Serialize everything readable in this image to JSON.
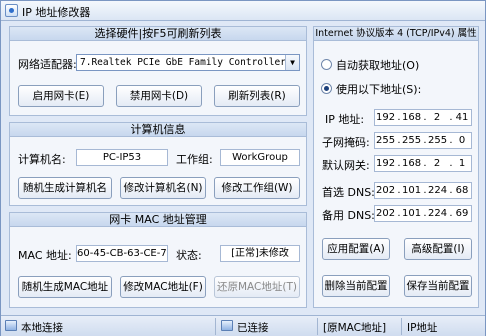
{
  "window": {
    "title": "IP 地址修改器"
  },
  "hardware": {
    "header": "选择硬件|按F5可刷新列表",
    "adapter_label": "网络适配器:",
    "adapter_value": "7.Realtek PCIe GbE Family Controller",
    "enable_btn": "启用网卡(E)",
    "disable_btn": "禁用网卡(D)",
    "refresh_btn": "刷新列表(R)"
  },
  "computer": {
    "header": "计算机信息",
    "name_label": "计算机名:",
    "name_value": "PC-IP53",
    "workgroup_label": "工作组:",
    "workgroup_value": "WorkGroup",
    "random_name_btn": "随机生成计算机名",
    "change_name_btn": "修改计算机名(N)",
    "change_workgroup_btn": "修改工作组(W)"
  },
  "mac": {
    "header": "网卡 MAC 地址管理",
    "mac_label": "MAC 地址:",
    "mac_value": "60-45-CB-63-CE-7C",
    "state_label": "状态:",
    "state_value": "[正常]未修改",
    "random_mac_btn": "随机生成MAC地址",
    "change_mac_btn": "修改MAC地址(F)",
    "restore_mac_btn": "还原MAC地址(T)"
  },
  "ipv4": {
    "header": "Internet 协议版本 4 (TCP/IPv4) 属性",
    "auto_label": "自动获取地址(O)",
    "manual_label": "使用以下地址(S):",
    "selected": "manual",
    "ip_label": "IP 地址:",
    "ip": [
      "192",
      "168",
      "2",
      "41"
    ],
    "mask_label": "子网掩码:",
    "mask": [
      "255",
      "255",
      "255",
      "0"
    ],
    "gateway_label": "默认网关:",
    "gateway": [
      "192",
      "168",
      "2",
      "1"
    ],
    "dns1_label": "首选 DNS:",
    "dns1": [
      "202",
      "101",
      "224",
      "68"
    ],
    "dns2_label": "备用 DNS:",
    "dns2": [
      "202",
      "101",
      "224",
      "69"
    ],
    "apply_btn": "应用配置(A)",
    "advanced_btn": "高级配置(I)",
    "delete_btn": "删除当前配置",
    "save_btn": "保存当前配置"
  },
  "status": {
    "local": "本地连接",
    "connected": "已连接",
    "mac_state": "[原MAC地址]",
    "ip_state": "IP地址"
  }
}
